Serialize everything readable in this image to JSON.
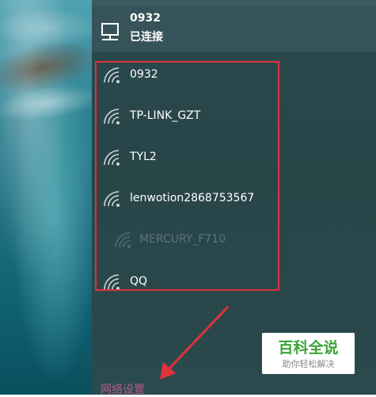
{
  "connected": {
    "name": "0932",
    "status": "已连接",
    "icon": "monitor-icon"
  },
  "networks": [
    {
      "name": "0932",
      "icon": "wifi-icon",
      "dim": false
    },
    {
      "name": "TP-LINK_GZT",
      "icon": "wifi-icon",
      "dim": false
    },
    {
      "name": "TYL2",
      "icon": "wifi-icon",
      "dim": false
    },
    {
      "name": "lenwotion2868753567",
      "icon": "wifi-icon",
      "dim": false
    },
    {
      "name": "MERCURY_F710",
      "icon": "wifi-icon",
      "dim": true
    },
    {
      "name": "QQ",
      "icon": "wifi-icon",
      "dim": false
    }
  ],
  "footer": {
    "network_settings": "网络设置"
  },
  "watermark": {
    "title": "百科全说",
    "subtitle": "助你轻松解决"
  },
  "colors": {
    "panel": "#284548",
    "highlight": "#e0323a",
    "link": "#b55a86",
    "watermark_green": "#3aa537"
  }
}
